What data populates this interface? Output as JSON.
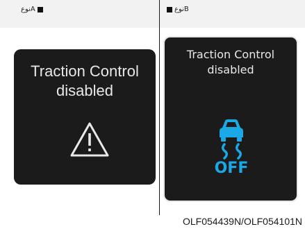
{
  "type_a": {
    "label": "نوعA"
  },
  "type_b": {
    "label": "نوعB"
  },
  "panel_a": {
    "line1": "Traction Control",
    "line2": "disabled"
  },
  "panel_b": {
    "line1": "Traction Control",
    "line2": "disabled",
    "status": "OFF"
  },
  "caption": "OLF054439N/OLF054101N",
  "colors": {
    "panel": "#1b1b1b",
    "text": "#e8e8e8",
    "accent": "#1aa9e6"
  },
  "icons": {
    "panel_a": "warning-triangle-icon",
    "panel_b": "traction-control-off-icon"
  }
}
